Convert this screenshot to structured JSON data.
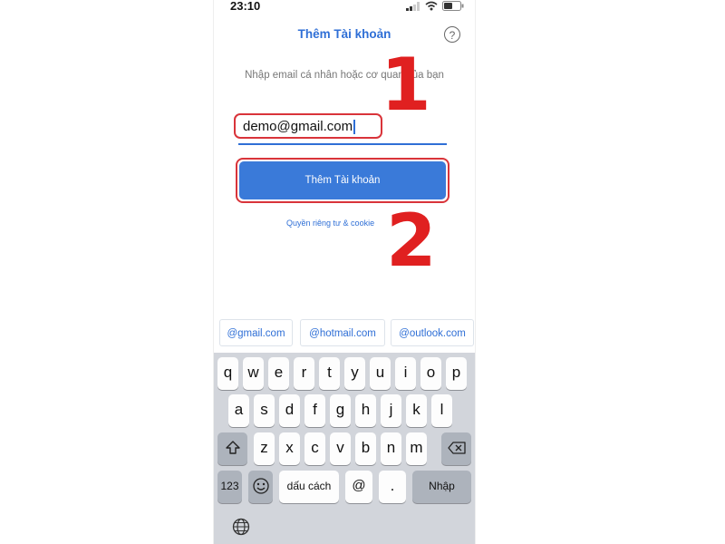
{
  "status_bar": {
    "time": "23:10"
  },
  "header": {
    "title": "Thêm Tài khoản",
    "help_label": "?"
  },
  "form": {
    "subtitle": "Nhập email cá nhân hoặc cơ quan của bạn",
    "email_value": "demo@gmail.com",
    "add_button_label": "Thêm Tài khoản",
    "privacy_link": "Quyền riêng tư & cookie"
  },
  "suggestions": [
    "@gmail.com",
    "@hotmail.com",
    "@outlook.com"
  ],
  "keyboard": {
    "row1": [
      "q",
      "w",
      "e",
      "r",
      "t",
      "y",
      "u",
      "i",
      "o",
      "p"
    ],
    "row2": [
      "a",
      "s",
      "d",
      "f",
      "g",
      "h",
      "j",
      "k",
      "l"
    ],
    "row3": [
      "z",
      "x",
      "c",
      "v",
      "b",
      "n",
      "m"
    ],
    "numbers_label": "123",
    "space_label": "dấu cách",
    "at_label": "@",
    "dot_label": ".",
    "return_label": "Nhập"
  },
  "annotations": {
    "step1": "1",
    "step2": "2"
  },
  "colors": {
    "accent": "#2f6fd6",
    "button": "#3a7ad9",
    "annotation": "#d9343a"
  }
}
